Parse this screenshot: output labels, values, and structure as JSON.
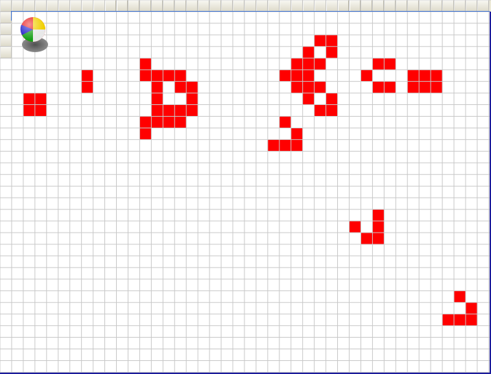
{
  "board": {
    "cols": 42,
    "rows": 31,
    "colors": {
      "live": "#ff0000",
      "dead": "#ffffff",
      "grid": "#c8c8c8",
      "header": "#ece9d8"
    },
    "live_cells": [
      [
        27,
        3
      ],
      [
        28,
        3
      ],
      [
        26,
        4
      ],
      [
        28,
        4
      ],
      [
        12,
        5
      ],
      [
        25,
        5
      ],
      [
        26,
        5
      ],
      [
        27,
        5
      ],
      [
        32,
        5
      ],
      [
        33,
        5
      ],
      [
        7,
        6
      ],
      [
        12,
        6
      ],
      [
        13,
        6
      ],
      [
        14,
        6
      ],
      [
        15,
        6
      ],
      [
        24,
        6
      ],
      [
        25,
        6
      ],
      [
        26,
        6
      ],
      [
        31,
        6
      ],
      [
        35,
        6
      ],
      [
        36,
        6
      ],
      [
        37,
        6
      ],
      [
        7,
        7
      ],
      [
        13,
        7
      ],
      [
        15,
        7
      ],
      [
        16,
        7
      ],
      [
        25,
        7
      ],
      [
        26,
        7
      ],
      [
        27,
        7
      ],
      [
        32,
        7
      ],
      [
        33,
        7
      ],
      [
        35,
        7
      ],
      [
        36,
        7
      ],
      [
        37,
        7
      ],
      [
        2,
        8
      ],
      [
        3,
        8
      ],
      [
        13,
        8
      ],
      [
        16,
        8
      ],
      [
        26,
        8
      ],
      [
        28,
        8
      ],
      [
        2,
        9
      ],
      [
        3,
        9
      ],
      [
        13,
        9
      ],
      [
        14,
        9
      ],
      [
        15,
        9
      ],
      [
        16,
        9
      ],
      [
        27,
        9
      ],
      [
        28,
        9
      ],
      [
        12,
        10
      ],
      [
        13,
        10
      ],
      [
        14,
        10
      ],
      [
        15,
        10
      ],
      [
        24,
        10
      ],
      [
        12,
        11
      ],
      [
        25,
        11
      ],
      [
        23,
        12
      ],
      [
        24,
        12
      ],
      [
        25,
        12
      ],
      [
        32,
        18
      ],
      [
        30,
        19
      ],
      [
        32,
        19
      ],
      [
        31,
        20
      ],
      [
        32,
        20
      ],
      [
        39,
        25
      ],
      [
        40,
        26
      ],
      [
        38,
        27
      ],
      [
        39,
        27
      ],
      [
        40,
        27
      ]
    ]
  },
  "toolbar": {
    "icon": "beach-ball-icon"
  }
}
